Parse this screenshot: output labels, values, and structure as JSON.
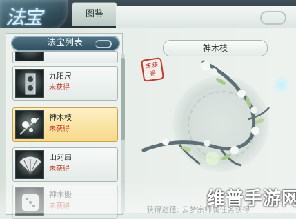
{
  "header": {
    "logo_text": "法宝",
    "tab_label": "图鉴"
  },
  "list": {
    "title": "法宝列表",
    "items": [
      {
        "name": "九阳尺",
        "status": "未获得",
        "icon": "ruler-artifact-icon"
      },
      {
        "name": "神木枝",
        "status": "未获得",
        "icon": "branch-artifact-icon"
      },
      {
        "name": "山河扇",
        "status": "未获得",
        "icon": "fan-artifact-icon"
      },
      {
        "name": "神木骰",
        "status": "未获得",
        "icon": "dice-artifact-icon"
      }
    ]
  },
  "detail": {
    "title": "神木枝",
    "seal_text": "未获得",
    "source_text": "获得途径: 云梦宗师属任务获得"
  },
  "watermark": "维普手游网",
  "colors": {
    "accent": "#2f4c5a",
    "selected": "#f7d98a",
    "status_red": "#c0392b"
  }
}
